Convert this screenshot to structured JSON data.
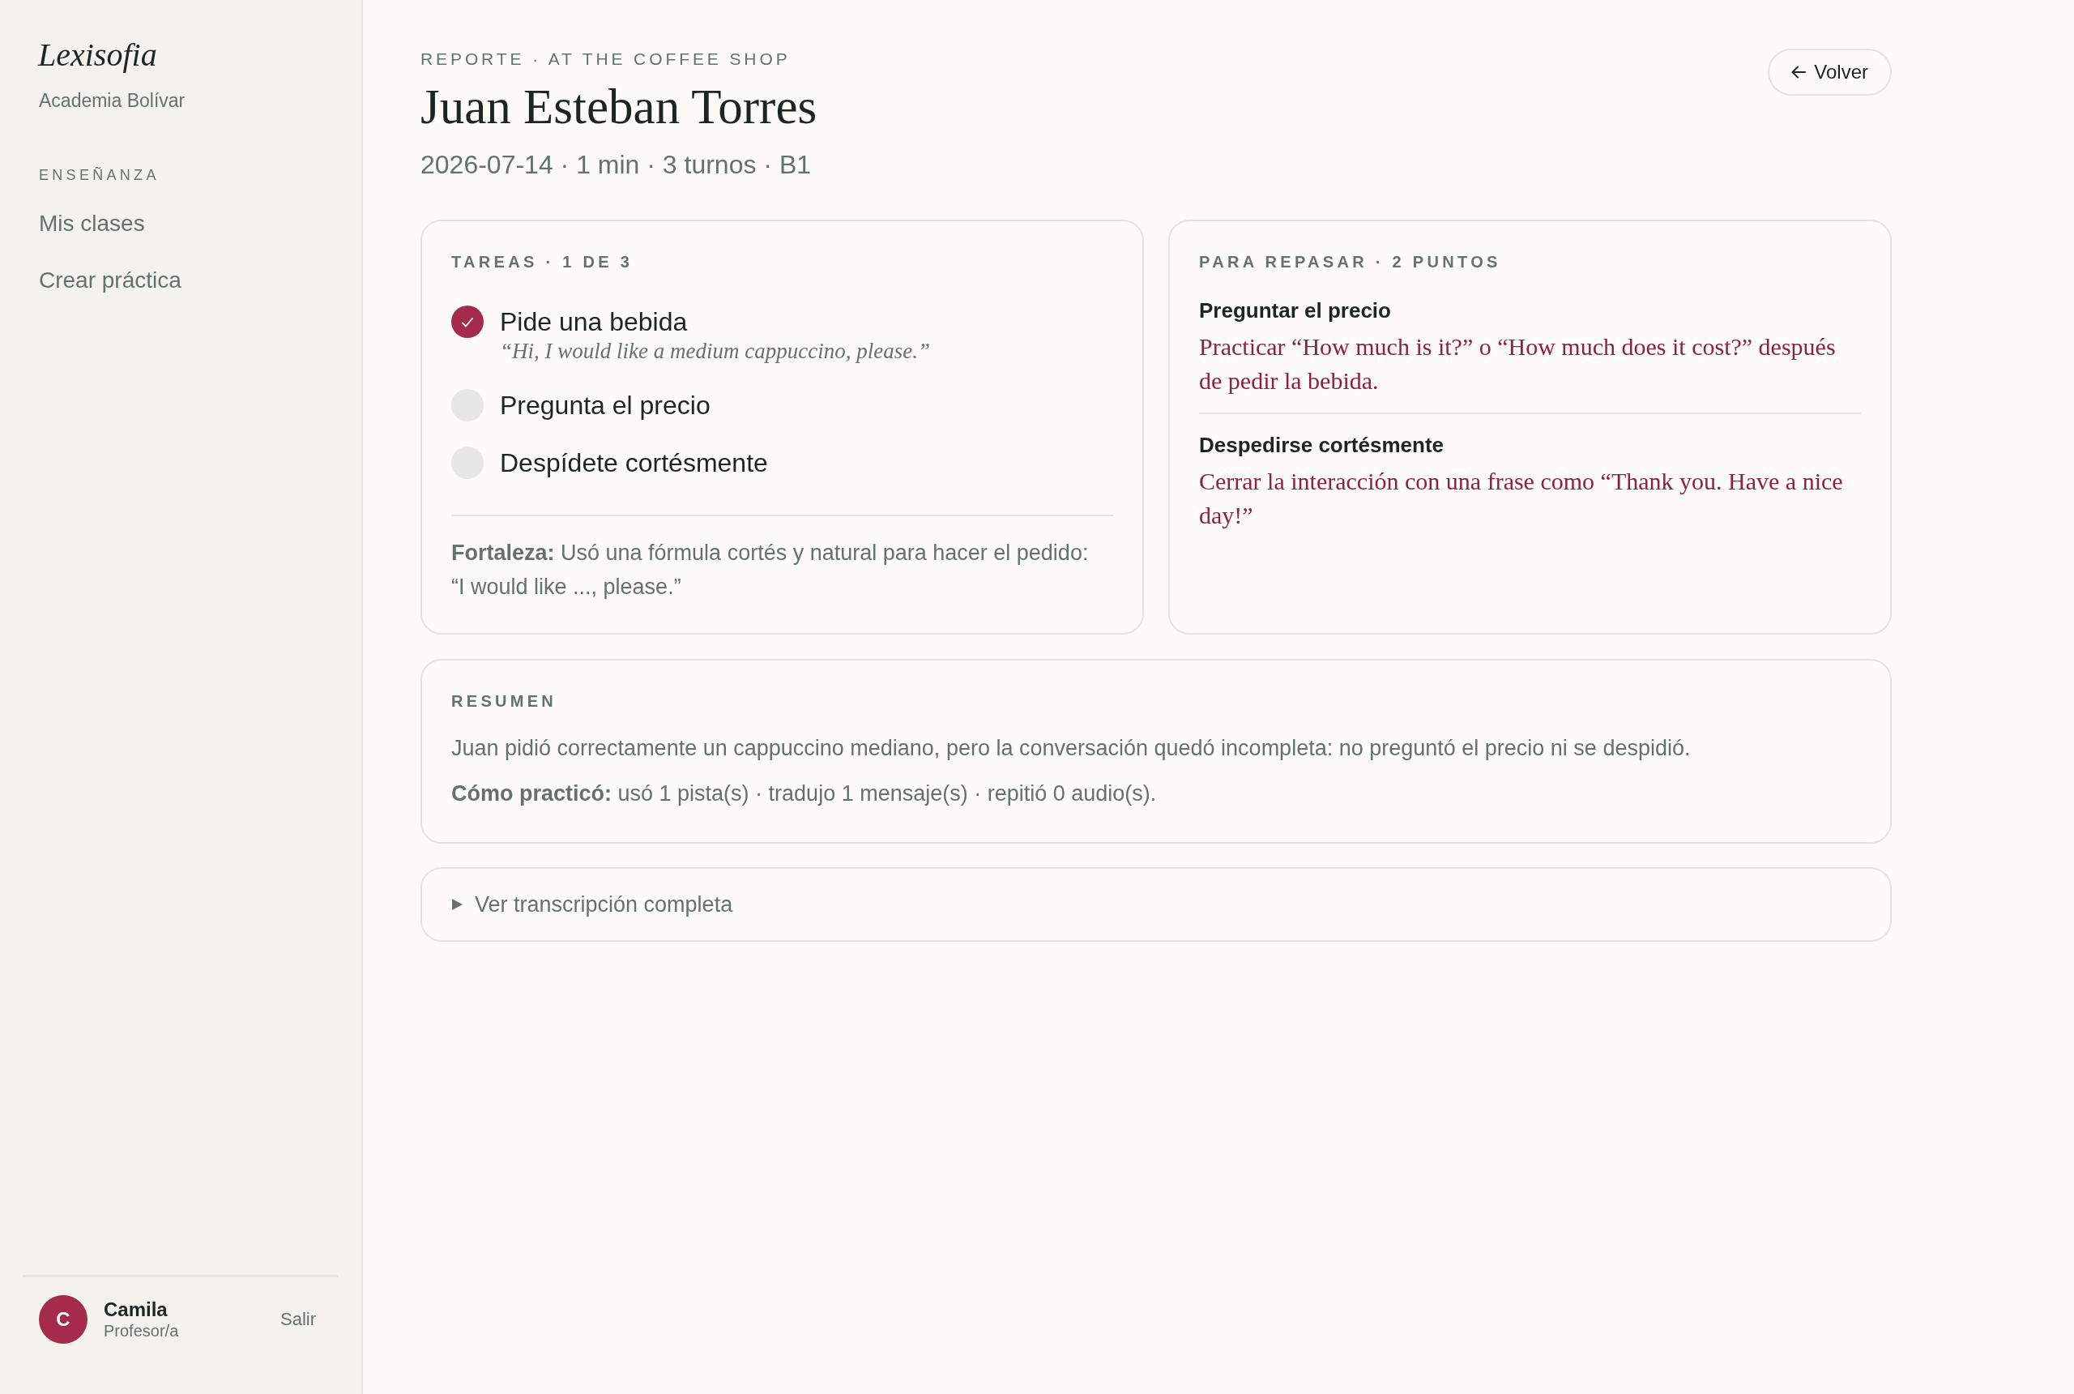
{
  "sidebar": {
    "brand": "Lexisofia",
    "organization": "Academia Bolívar",
    "section": "ENSEÑANZA",
    "items": [
      {
        "label": "Mis clases",
        "selected": false
      },
      {
        "label": "Crear práctica",
        "selected": false
      }
    ],
    "user": {
      "initial": "C",
      "name": "Camila",
      "role": "Profesor/a",
      "action": "Salir"
    }
  },
  "header": {
    "eyebrow": "REPORTE · AT THE COFFEE SHOP",
    "title": "Juan Esteban Torres",
    "meta": "2026-07-14 · 1 min · 3 turnos · B1",
    "back_button": "Volver"
  },
  "tasks": {
    "heading": "TAREAS · 1 DE 3",
    "items": [
      {
        "label": "Pide una bebida",
        "checked": true,
        "quote": "“Hi, I would like a medium cappuccino, please.”"
      },
      {
        "label": "Pregunta el precio",
        "checked": false
      },
      {
        "label": "Despídete cortésmente",
        "checked": false
      }
    ],
    "strength": "**Fortaleza:** Usó una fórmula cortés y natural para hacer el pedido: “I would like ..., please.”"
  },
  "review": {
    "heading": "PARA REPASAR · 2 PUNTOS",
    "items": [
      {
        "title": "Preguntar el precio",
        "description": "Practicar “How much is it?” o “How much does it cost?” después de pedir la bebida."
      },
      {
        "title": "Despedirse cortésmente",
        "description": "Cerrar la interacción con una frase como “Thank you. Have a nice day!”"
      }
    ]
  },
  "summary": {
    "heading": "RESUMEN",
    "text": "Juan pidió correctamente un cappuccino mediano, pero la conversación quedó incompleta: no preguntó el precio ni se despidió.",
    "practice": "**Cómo practicó:** usó 1 pista(s) · tradujo 1 mensaje(s) · repitió 0 audio(s)."
  },
  "transcript": {
    "label": "Ver transcripción completa",
    "expanded": false
  }
}
